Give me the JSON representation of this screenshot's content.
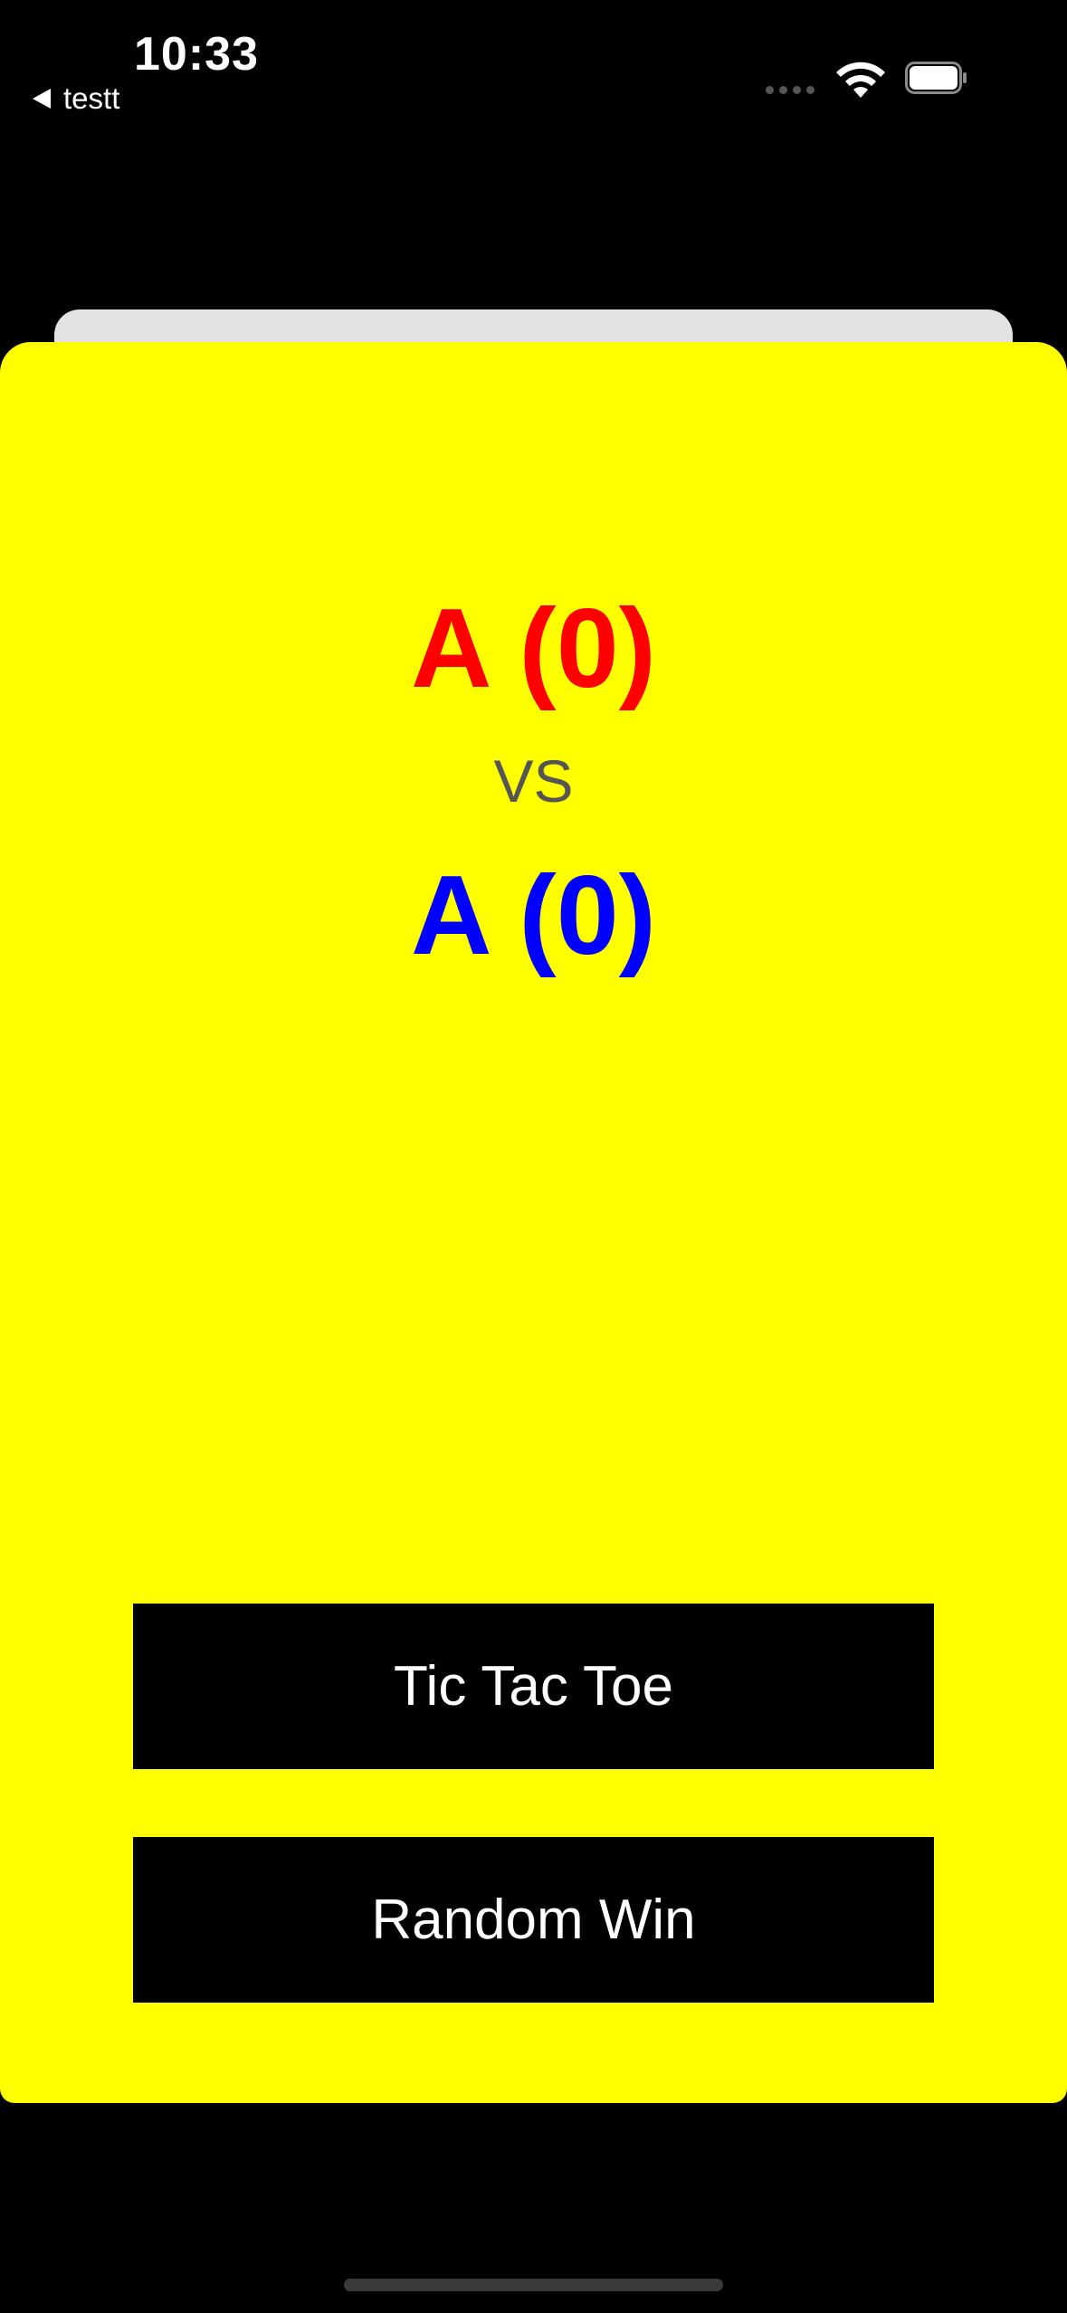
{
  "status_bar": {
    "time": "10:33",
    "back_label": "testt",
    "icons": [
      "signal-dots-icon",
      "wifi-icon",
      "battery-icon"
    ]
  },
  "scoreboard": {
    "player_one": "A (0)",
    "versus": "VS",
    "player_two": "A (0)"
  },
  "actions": {
    "tic_tac_toe_label": "Tic Tac Toe",
    "random_win_label": "Random Win"
  },
  "colors": {
    "background": "#000000",
    "sheet": "#ffff00",
    "player_one": "#ff0000",
    "player_two": "#0000ff",
    "versus": "#555555",
    "button": "#000000",
    "button_text": "#ffffff"
  }
}
